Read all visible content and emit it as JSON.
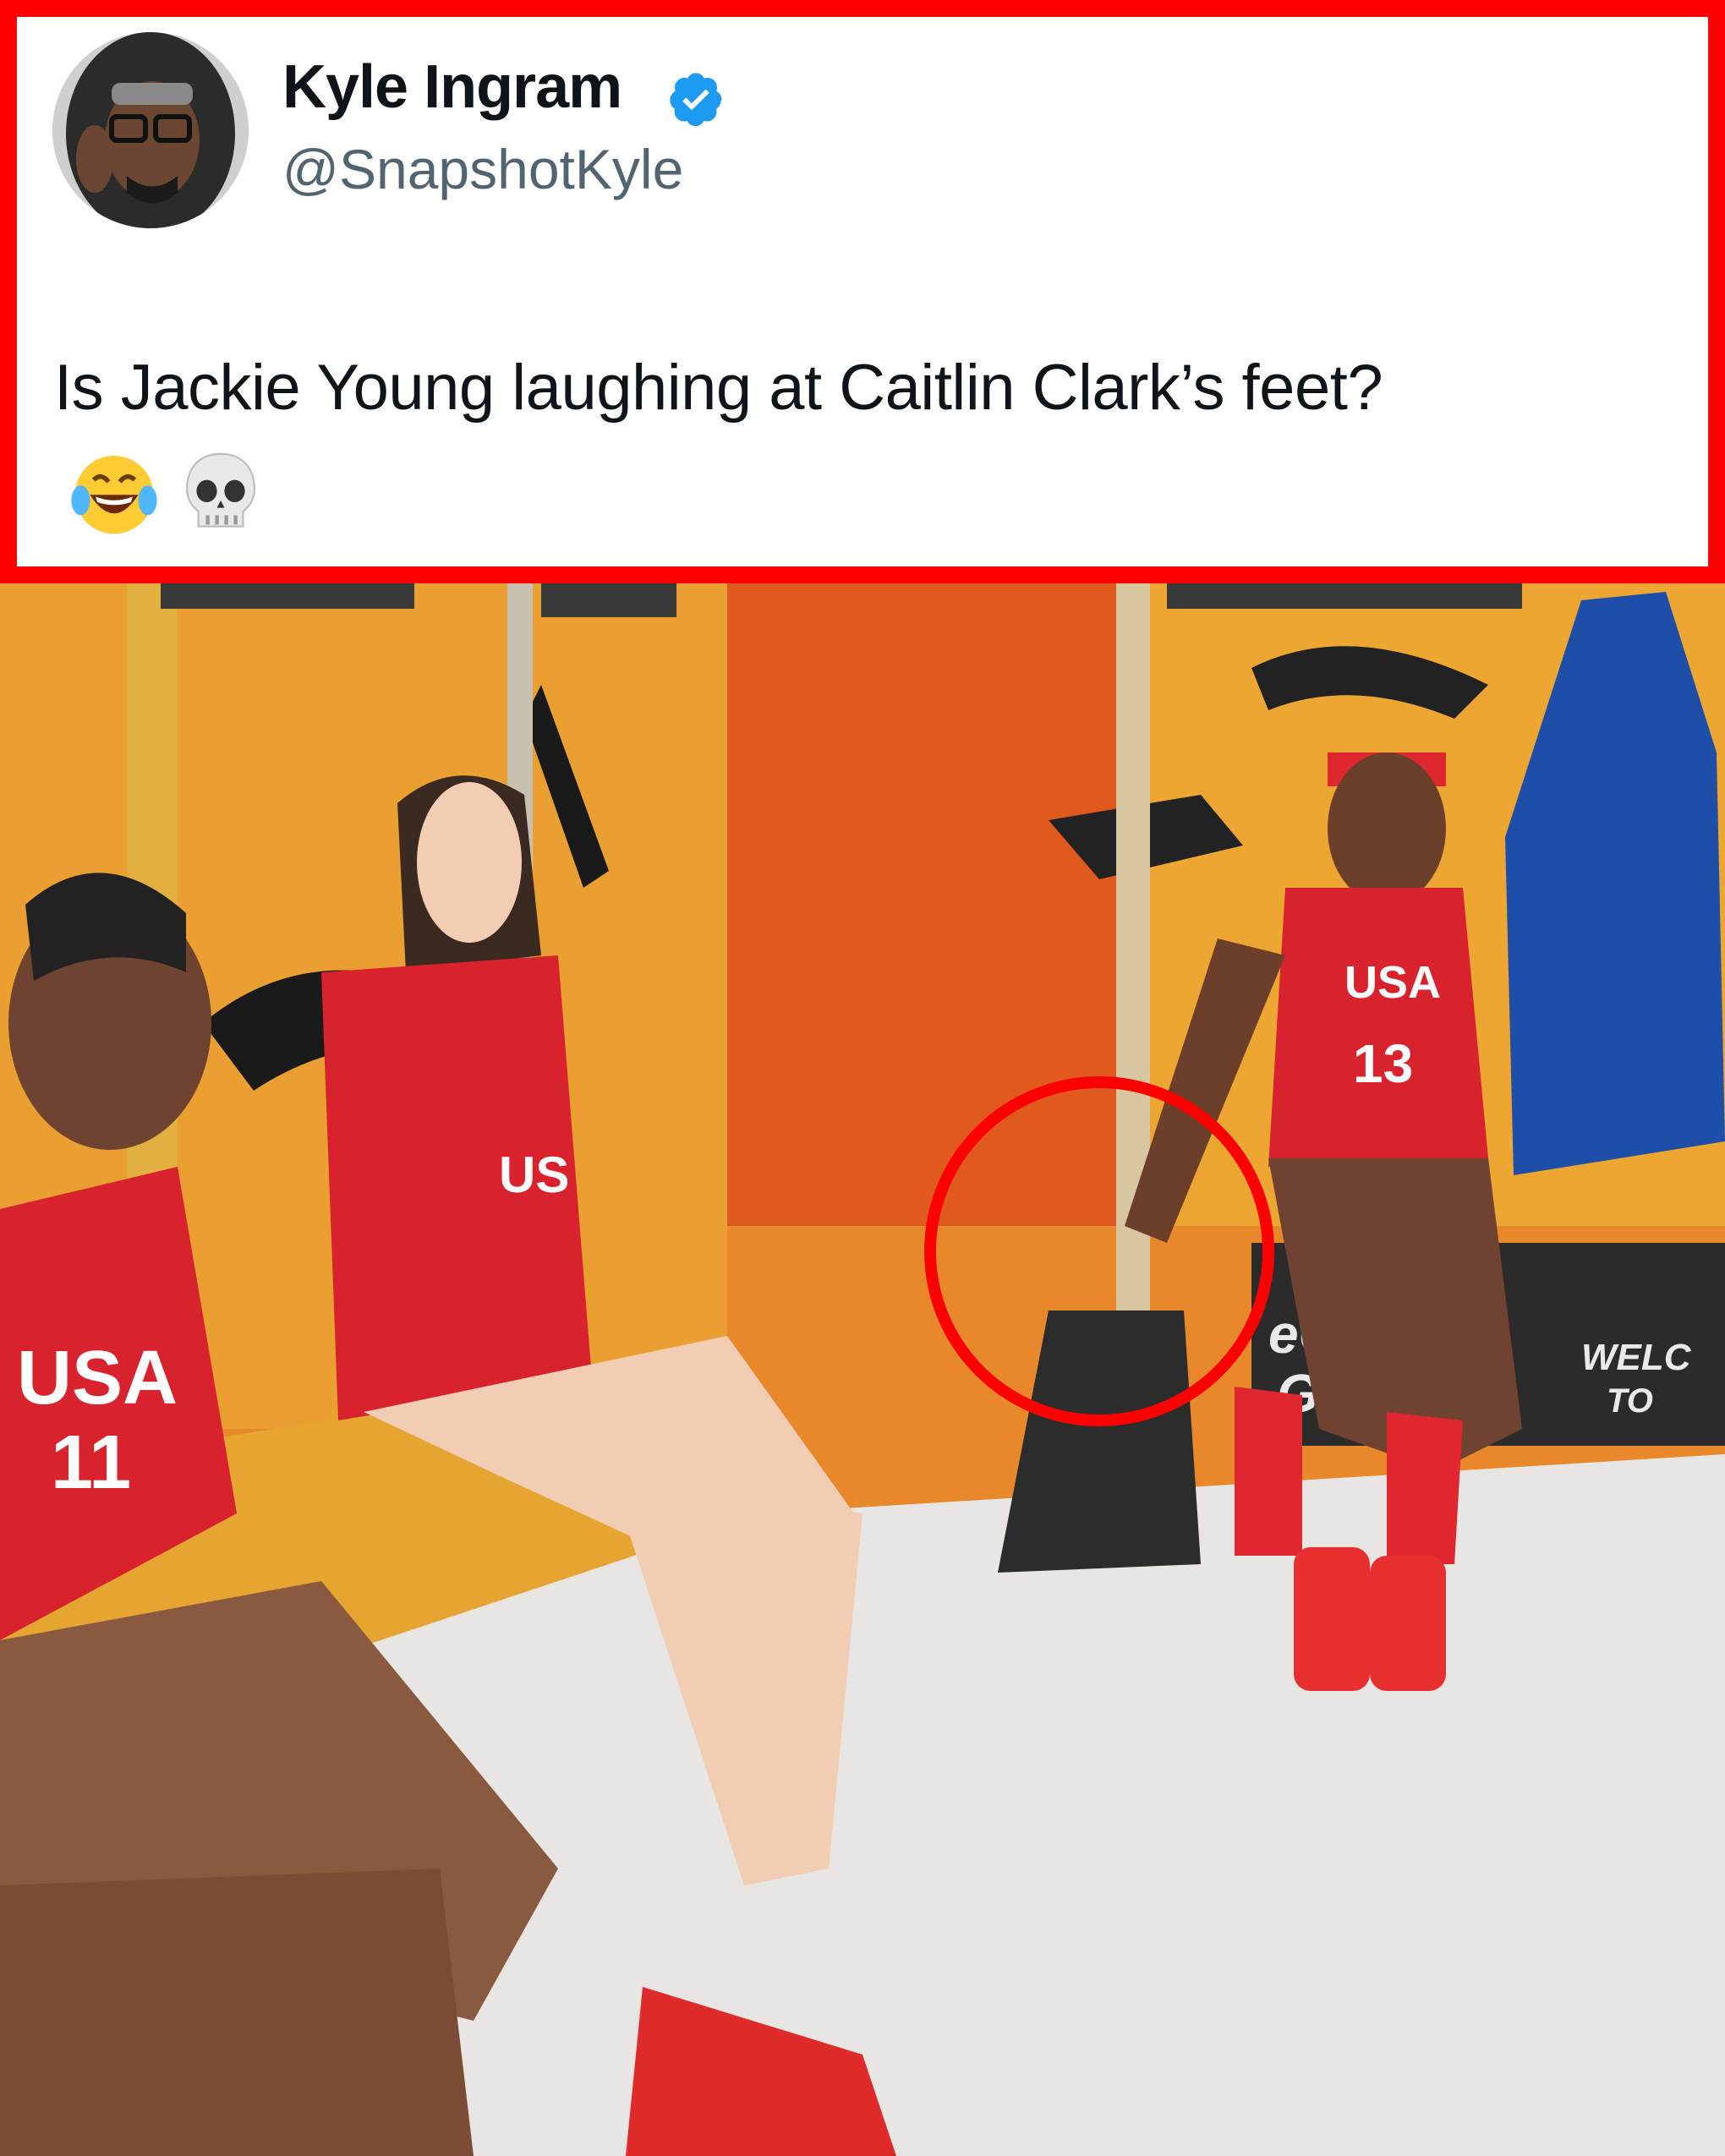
{
  "tweet": {
    "display_name": "Kyle Ingram",
    "handle": "@SnapshotKyle",
    "text": "Is Jackie Young laughing at Caitlin Clark’s feet?",
    "emojis": [
      "laughing-tears-emoji",
      "skull-emoji"
    ],
    "verified_icon": "verified-badge-icon"
  },
  "photo": {
    "jersey_left": "USA",
    "jersey_left_number": "11",
    "jersey_right": "USA",
    "jersey_right_number": "13",
    "banner_text_1": "eOwn",
    "banner_text_2": "Game",
    "banner_text_3": "WELC",
    "banner_text_4": "TO"
  },
  "colors": {
    "highlight_red": "#fe0000",
    "jersey_red": "#d8232f",
    "locker_orange": "#e98a2a",
    "verified_blue": "#1d9bf0"
  }
}
